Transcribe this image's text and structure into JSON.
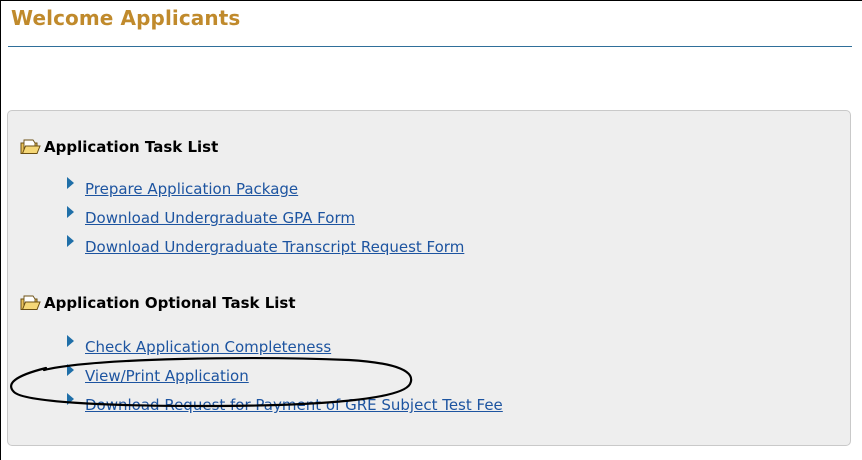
{
  "page": {
    "title": "Welcome Applicants"
  },
  "sections": [
    {
      "heading": "Application Task List",
      "icon": "folder-icon",
      "items": [
        {
          "label": "Prepare Application Package"
        },
        {
          "label": "Download Undergraduate GPA Form"
        },
        {
          "label": "Download Undergraduate Transcript Request Form"
        }
      ]
    },
    {
      "heading": "Application Optional Task List",
      "icon": "folder-icon",
      "items": [
        {
          "label": "Check Application Completeness"
        },
        {
          "label": "View/Print Application"
        },
        {
          "label": "Download Request for Payment of GRE Subject Test Fee"
        }
      ]
    }
  ],
  "colors": {
    "title": "#c08a2c",
    "link": "#1d54a0",
    "panel_background": "#eeeeee",
    "bullet": "#1f6fa8",
    "rule": "#2f6f9a"
  }
}
